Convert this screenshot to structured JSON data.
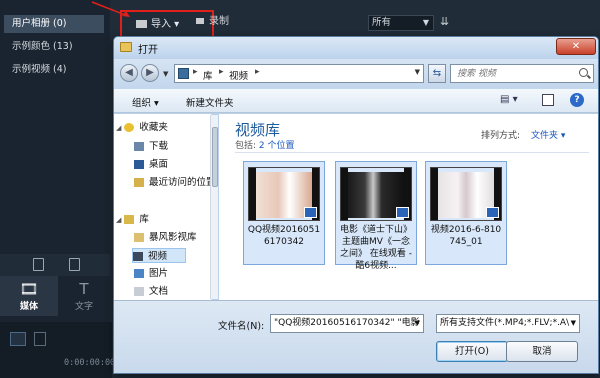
{
  "app": {
    "albums": [
      "用户相册 (0)",
      "示例颜色 (13)",
      "示例视频 (4)"
    ],
    "import_label": "导入",
    "record_label": "录制",
    "filter_value": "所有",
    "tabs": {
      "media": "媒体",
      "text": "文字"
    },
    "timecode": "0:00:00:00"
  },
  "dialog": {
    "title": "打开",
    "close_glyph": "✕",
    "address": {
      "part1": "库",
      "part2": "视频"
    },
    "search_placeholder": "搜索 视频",
    "toolbar": {
      "organize": "组织 ▾",
      "new_folder": "新建文件夹"
    },
    "nav": {
      "favorites": "收藏夹",
      "downloads": "下载",
      "desktop": "桌面",
      "recent": "最近访问的位置",
      "libraries": "库",
      "storm": "暴风影视库",
      "videos": "视频",
      "pictures": "图片",
      "documents": "文档"
    },
    "library": {
      "title": "视频库",
      "sub_prefix": "包括: ",
      "sub_link": "2 个位置",
      "sort_label": "排列方式:",
      "sort_value": "文件夹 ▾"
    },
    "files": [
      {
        "name": "QQ视频20160516170342"
      },
      {
        "name": "电影《道士下山》主题曲MV《一念之间》 在线观看 - 酷6视频..."
      },
      {
        "name": "视频2016-6-810745_01"
      }
    ],
    "filename_label": "文件名(N):",
    "filename_value": "\"QQ视频20160516170342\" \"电影",
    "filetype_value": "所有支持文件(*.MP4;*.FLV;*.A\\",
    "open_label": "打开(O)",
    "cancel_label": "取消"
  },
  "colors": {
    "annotation": "#e0201a",
    "link": "#1a56c0",
    "library_title": "#1e5b9a"
  }
}
